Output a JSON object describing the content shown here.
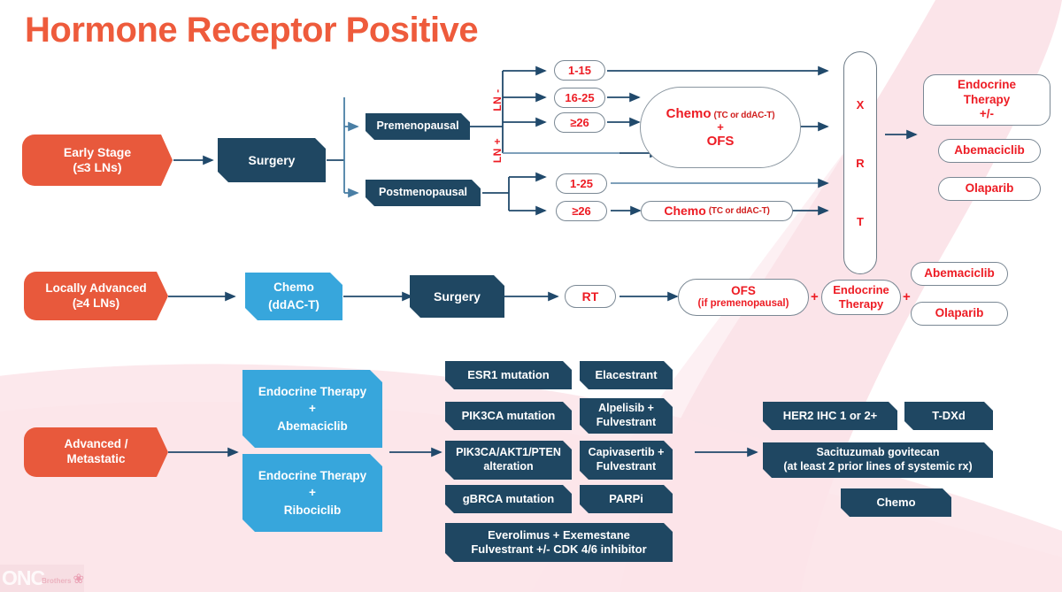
{
  "title": "Hormone Receptor Positive",
  "colors": {
    "orange": "#E8593C",
    "navy": "#1F4762",
    "blue": "#37A6DC",
    "red_text": "#ED1C24",
    "title": "#EE5B3C",
    "outline": "#7A8894",
    "ribbon_watermark": "#FAE3E8"
  },
  "logo": {
    "name": "ONC",
    "sub": "Brothers",
    "icon": "pink-ribbon-icon"
  },
  "early_stage": {
    "entry": {
      "line1": "Early Stage",
      "line2": "(≤3 LNs)"
    },
    "surgery": "Surgery",
    "premenopausal": "Premenopausal",
    "postmenopausal": "Postmenopausal",
    "ln_negative_label": "LN -",
    "ln_positive_label": "LN +",
    "pre_scores": [
      "1-15",
      "16-25",
      "≥26"
    ],
    "post_scores": [
      "1-25",
      "≥26"
    ],
    "chemo_ofs": {
      "main": "Chemo",
      "detail": "(TC or ddAC-T)",
      "plus": "+",
      "second": "OFS"
    },
    "chemo_post": {
      "main": "Chemo",
      "detail": "(TC or ddAC-T)"
    },
    "xrt": [
      "X",
      "R",
      "T"
    ],
    "endocrine": {
      "line1": "Endocrine",
      "line2": "Therapy",
      "line3": "+/-"
    },
    "abemaciclib": "Abemaciclib",
    "olaparib": "Olaparib"
  },
  "locally_advanced": {
    "entry": {
      "line1": "Locally Advanced",
      "line2": "(≥4 LNs)"
    },
    "chemo": {
      "line1": "Chemo",
      "line2": "(ddAC-T)"
    },
    "surgery": "Surgery",
    "rt": "RT",
    "ofs": {
      "line1": "OFS",
      "line2": "(if premenopausal)"
    },
    "plus1": "+",
    "endocrine": {
      "line1": "Endocrine",
      "line2": "Therapy"
    },
    "plus2": "+",
    "abemaciclib": "Abemaciclib",
    "olaparib": "Olaparib"
  },
  "advanced": {
    "entry": {
      "line1": "Advanced /",
      "line2": "Metastatic"
    },
    "first_line": [
      {
        "line1": "Endocrine Therapy",
        "line2": "+",
        "line3": "Abemaciclib"
      },
      {
        "line1": "Endocrine Therapy",
        "line2": "+",
        "line3": "Ribociclib"
      }
    ],
    "biomarkers": [
      {
        "marker": "ESR1 mutation",
        "therapy": "Elacestrant"
      },
      {
        "marker": "PIK3CA mutation",
        "therapy_line1": "Alpelisib +",
        "therapy_line2": "Fulvestrant"
      },
      {
        "marker_line1": "PIK3CA/AKT1/PTEN",
        "marker_line2": "alteration",
        "therapy_line1": "Capivasertib +",
        "therapy_line2": "Fulvestrant"
      },
      {
        "marker": "gBRCA mutation",
        "therapy": "PARPi"
      }
    ],
    "everolimus": {
      "line1": "Everolimus + Exemestane",
      "line2": "Fulvestrant +/- CDK 4/6 inhibitor"
    },
    "later_lines": {
      "her2": "HER2 IHC 1 or 2+",
      "tdxd": "T-DXd",
      "sacituzumab_line1": "Sacituzumab govitecan",
      "sacituzumab_line2": "(at least 2 prior lines of systemic rx)",
      "chemo": "Chemo"
    }
  }
}
